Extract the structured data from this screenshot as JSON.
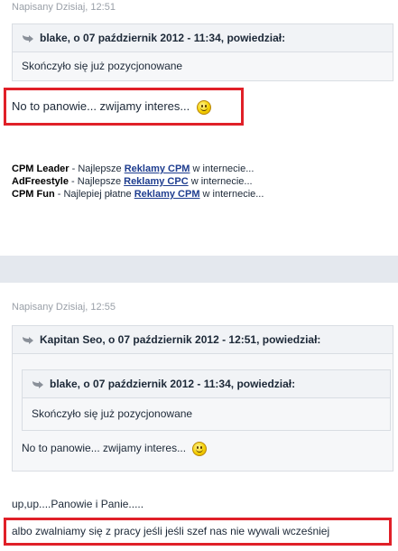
{
  "post1": {
    "meta": "Napisany Dzisiaj, 12:51",
    "quote_header": "blake, o 07 październik 2012 - 11:34, powiedział:",
    "quote_text": "Skończyło się już pozycjonowane",
    "message": "No to panowie... zwijamy interes...",
    "signature": [
      {
        "name": "CPM Leader",
        "pre": " - Najlepsze ",
        "link": "Reklamy CPM",
        "post": " w internecie..."
      },
      {
        "name": "AdFreestyle",
        "pre": " - Najlepsze ",
        "link": "Reklamy CPC",
        "post": " w internecie..."
      },
      {
        "name": "CPM Fun",
        "pre": " - Najlepiej płatne ",
        "link": "Reklamy CPM",
        "post": " w internecie..."
      }
    ]
  },
  "post2": {
    "meta": "Napisany Dzisiaj, 12:55",
    "outer_quote_header": "Kapitan Seo, o 07 październik 2012 - 12:51, powiedział:",
    "inner_quote_header": "blake, o 07 październik 2012 - 11:34, powiedział:",
    "inner_quote_text": "Skończyło się już pozycjonowane",
    "outer_quote_text": "No to panowie... zwijamy interes...",
    "line1": "up,up....Panowie i Panie.....",
    "line2": "albo zwalniamy się z pracy jeśli jeśli szef nas nie wywali wcześniej"
  },
  "colors": {
    "highlight": "#e02028",
    "link": "#1e3d8f",
    "band": "#e4e8ee"
  }
}
